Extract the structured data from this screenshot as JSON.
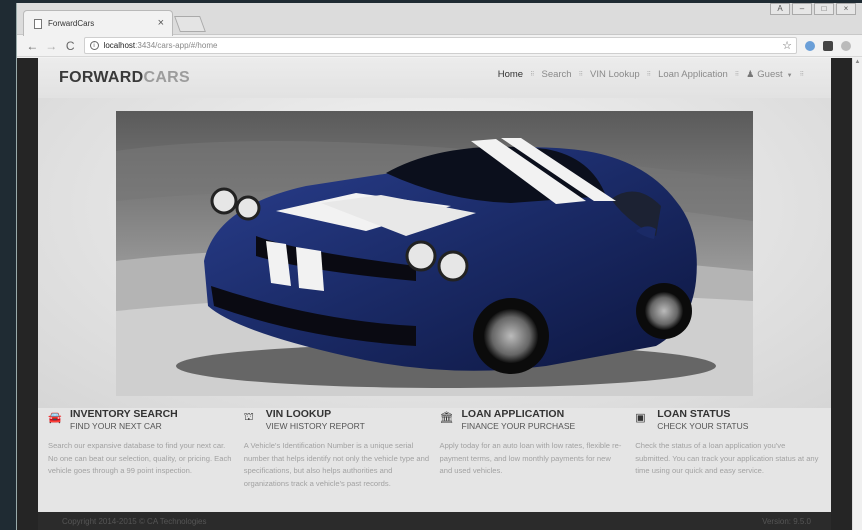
{
  "browser": {
    "tab_title": "ForwardCars",
    "url_host": "localhost",
    "url_path": ":3434/cars-app/#/home"
  },
  "site": {
    "logo_primary": "FORWARD",
    "logo_secondary": "CARS",
    "nav": [
      {
        "label": "Home",
        "active": true
      },
      {
        "label": "Search"
      },
      {
        "label": "VIN Lookup"
      },
      {
        "label": "Loan Application"
      },
      {
        "label": "Guest",
        "icon": "user-icon"
      }
    ],
    "features": [
      {
        "icon": "car-icon",
        "title": "INVENTORY SEARCH",
        "subtitle": "FIND YOUR NEXT CAR",
        "body": "Search our expansive database to find your next car. No one can beat our selection, quality, or pricing. Each vehicle goes through a 99 point inspection."
      },
      {
        "icon": "binoculars-icon",
        "title": "VIN LOOKUP",
        "subtitle": "VIEW HISTORY REPORT",
        "body": "A Vehicle's Identification Number is a unique serial number that helps identify not only the vehicle type and specifications, but also helps authorities and organizations track a vehicle's past records."
      },
      {
        "icon": "bank-icon",
        "title": "LOAN APPLICATION",
        "subtitle": "FINANCE YOUR PURCHASE",
        "body": "Apply today for an auto loan with low rates, flexible re-payment terms, and low monthly payments for new and used vehicles."
      },
      {
        "icon": "money-icon",
        "title": "LOAN STATUS",
        "subtitle": "CHECK YOUR STATUS",
        "body": "Check the status of a loan application you've submitted. You can track your application status at any time using our quick and easy service."
      }
    ],
    "footer": {
      "copyright": "Copyright 2014-2015 © CA Technologies",
      "version": "Version: 9.5.0"
    }
  }
}
